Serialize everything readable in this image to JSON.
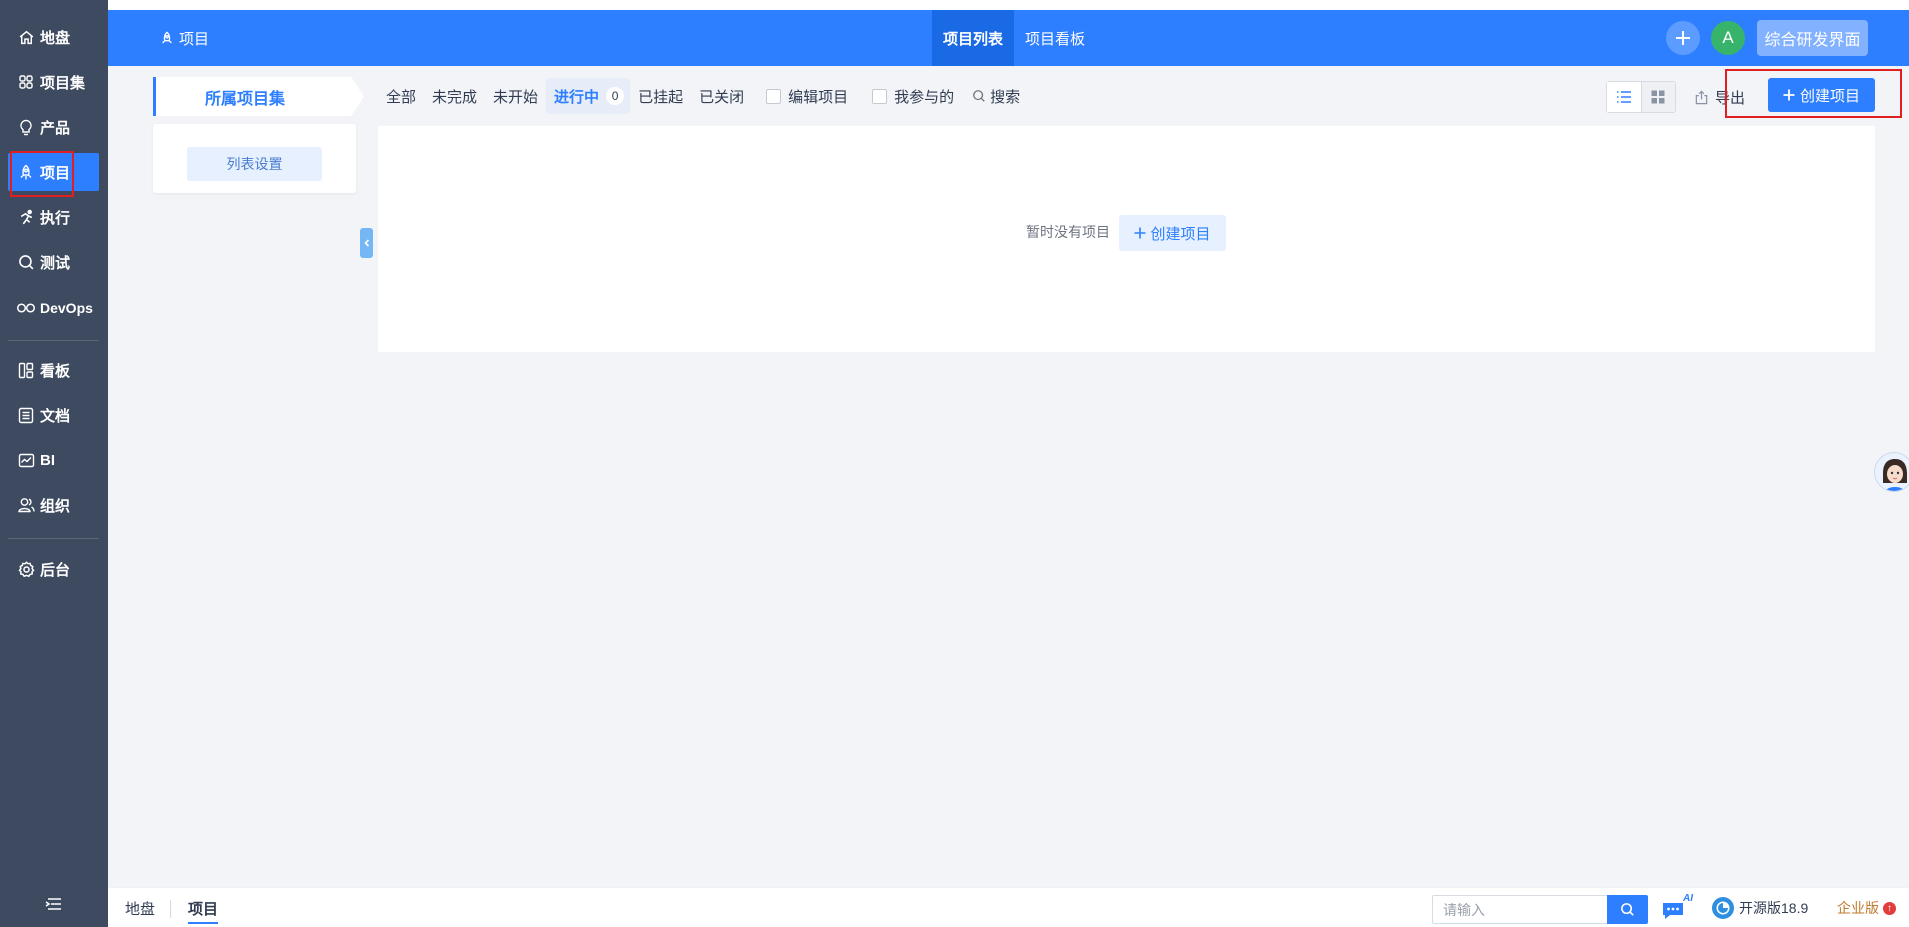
{
  "sidebar": {
    "items": [
      {
        "label": "地盘",
        "icon": "home-icon"
      },
      {
        "label": "项目集",
        "icon": "grid-icon"
      },
      {
        "label": "产品",
        "icon": "lightbulb-icon"
      },
      {
        "label": "项目",
        "icon": "rocket-icon"
      },
      {
        "label": "执行",
        "icon": "running-icon"
      },
      {
        "label": "测试",
        "icon": "magnifier-icon"
      },
      {
        "label": "DevOps",
        "icon": "infinity-icon"
      },
      {
        "label": "看板",
        "icon": "kanban-icon"
      },
      {
        "label": "文档",
        "icon": "document-icon"
      },
      {
        "label": "BI",
        "icon": "chart-icon"
      },
      {
        "label": "组织",
        "icon": "people-icon"
      },
      {
        "label": "后台",
        "icon": "gear-icon"
      }
    ],
    "toggle_icon": "menu-collapse-icon"
  },
  "header": {
    "breadcrumb": "项目",
    "tabs": [
      "项目列表",
      "项目看板"
    ],
    "avatar_letter": "A",
    "workspace_label": "综合研发界面"
  },
  "program": {
    "title": "所属项目集",
    "list_setting": "列表设置"
  },
  "filters": {
    "all": "全部",
    "unfinished": "未完成",
    "not_started": "未开始",
    "in_progress": "进行中",
    "in_progress_count": "0",
    "suspended": "已挂起",
    "closed": "已关闭",
    "edit_project": "编辑项目",
    "my_involved": "我参与的",
    "search": "搜索"
  },
  "actions": {
    "export": "导出",
    "create": "创建项目"
  },
  "empty": {
    "message": "暂时没有项目",
    "create": "创建项目"
  },
  "bottom": {
    "crumbs": [
      "地盘",
      "项目"
    ],
    "search_placeholder": "请输入",
    "ai_badge": "AI",
    "version": "开源版18.9",
    "edition": "企业版"
  },
  "colors": {
    "sidebar": "#3e4a5f",
    "primary": "#2e7fff",
    "highlight_box": "#e02020"
  }
}
